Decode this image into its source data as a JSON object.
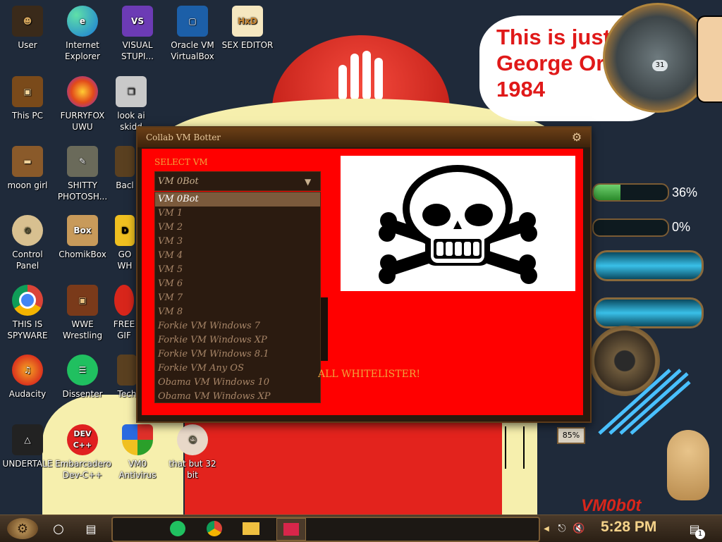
{
  "desktop_icons": [
    {
      "label": "User"
    },
    {
      "label": "Internet Explorer"
    },
    {
      "label": "VISUAL STUPI..."
    },
    {
      "label": "Oracle VM VirtualBox"
    },
    {
      "label": "SEX EDITOR"
    },
    {
      "label": "This PC"
    },
    {
      "label": "FURRYFOX UWU"
    },
    {
      "label": "look ai skidd"
    },
    {
      "label": "moon girl"
    },
    {
      "label": "SHITTY PHOTOSH..."
    },
    {
      "label": "Bacl"
    },
    {
      "label": "Control Panel"
    },
    {
      "label": "ChomikBox"
    },
    {
      "label": "GO WH"
    },
    {
      "label": "THIS IS SPYWARE"
    },
    {
      "label": "WWE Wrestling"
    },
    {
      "label": "FREE GIF"
    },
    {
      "label": "Audacity"
    },
    {
      "label": "Dissenter"
    },
    {
      "label": "Tech"
    },
    {
      "label": "UNDERTALE"
    },
    {
      "label": "Embarcadero Dev-C++"
    },
    {
      "label": "VM0 Antivirus"
    },
    {
      "label": "that but 32 bit"
    }
  ],
  "speech_bubble": {
    "text": "This is just like George Orwell's 1984"
  },
  "app": {
    "title": "Collab VM Botter",
    "select_label": "SELECT VM",
    "selected_value": "VM 0Bot",
    "options": [
      "VM 0Bot",
      "VM 1",
      "VM 2",
      "VM 3",
      "VM 4",
      "VM 5",
      "VM 6",
      "VM 7",
      "VM 8",
      "Forkie VM Windows 7",
      "Forkie VM Windows XP",
      "Forkie VM Windows 8.1",
      "Forkie VM Any OS",
      "Obama VM Windows 10",
      "Obama VM Windows XP"
    ],
    "selected_index": 0,
    "whitelister_text": "ALL WHITELISTER!"
  },
  "widgets": {
    "gauge_1": {
      "label": "36%",
      "value": 0.36
    },
    "gauge_2": {
      "label": "0%",
      "value": 0.0
    },
    "small_readout": "85%",
    "clock_day": "31"
  },
  "watermark": "VM0b0t",
  "taskbar": {
    "time": "5:28 PM",
    "notification_count": "1"
  },
  "colors": {
    "app_body": "#ff0000",
    "accent_text": "#f0a43c",
    "clock_text": "#f4d28a"
  }
}
